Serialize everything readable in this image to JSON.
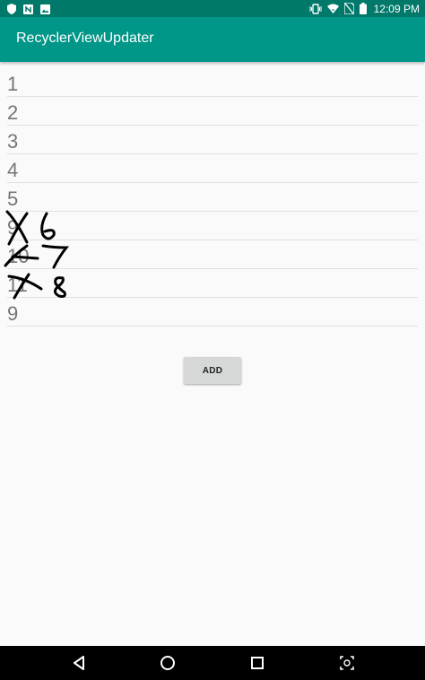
{
  "status_bar": {
    "time": "12:09 PM",
    "left_icons": [
      "shield-icon",
      "n-notification-icon",
      "image-icon"
    ],
    "right_icons": [
      "vibrate-icon",
      "wifi-icon",
      "no-sim-icon",
      "battery-icon"
    ]
  },
  "app_bar": {
    "title": "RecyclerViewUpdater",
    "color": "#009688",
    "status_color": "#00796b"
  },
  "list": {
    "items": [
      "1",
      "2",
      "3",
      "4",
      "5",
      "9",
      "10",
      "11",
      "9"
    ]
  },
  "add_button": {
    "label": "ADD"
  },
  "nav_bar": {
    "icons": [
      "back-icon",
      "home-icon",
      "recents-icon",
      "screenshot-icon"
    ]
  }
}
